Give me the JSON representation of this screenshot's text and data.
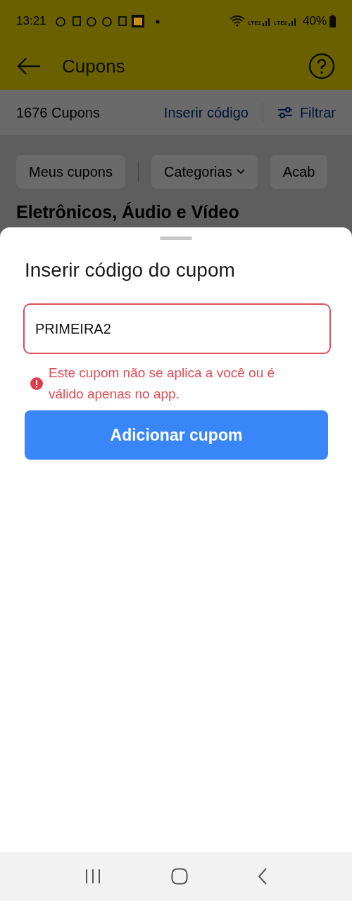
{
  "status_bar": {
    "time": "13:21",
    "sim_labels": [
      "LTE1",
      "LTE2"
    ],
    "battery": "40%"
  },
  "header": {
    "title": "Cupons"
  },
  "toolbar": {
    "count": "1676 Cupons",
    "insert_link": "Inserir código",
    "filter": "Filtrar"
  },
  "chips": [
    {
      "label": "Meus cupons",
      "dropdown": false
    },
    {
      "label": "Categorias",
      "dropdown": true
    },
    {
      "label": "Acab",
      "dropdown": false
    }
  ],
  "section_title": "Eletrônicos, Áudio e Vídeo",
  "sheet": {
    "title": "Inserir código do cupom",
    "field": {
      "value": "PRIMEIRA2",
      "error": true
    },
    "error_message": "Este cupom não se aplica a você ou é válido apenas no app.",
    "button": "Adicionar cupom"
  }
}
